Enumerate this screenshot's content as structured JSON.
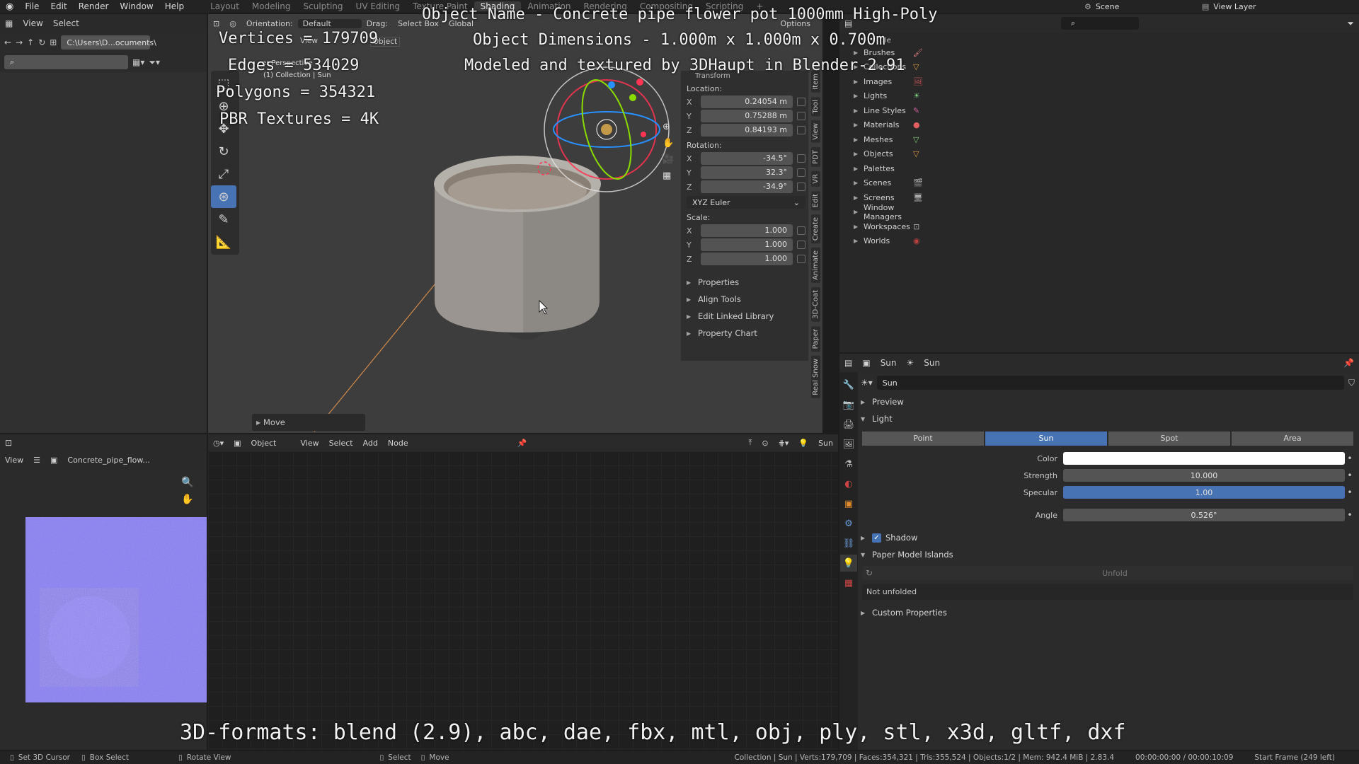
{
  "menu": {
    "items": [
      "File",
      "Edit",
      "Render",
      "Window",
      "Help"
    ],
    "workspaces": [
      "Layout",
      "Modeling",
      "Sculpting",
      "UV Editing",
      "Texture Paint",
      "Shading",
      "Animation",
      "Rendering",
      "Compositing",
      "Scripting"
    ],
    "active_workspace": "Shading",
    "add": "+",
    "scene_label": "Scene",
    "view_layer_label": "View Layer"
  },
  "file_browser": {
    "view": "View",
    "select": "Select",
    "path": "C:\\Users\\D...ocuments\\"
  },
  "viewport_header": {
    "orientation_label": "Orientation:",
    "orientation_value": "Default",
    "drag_label": "Drag:",
    "drag_value": "Select Box",
    "transform": "Global",
    "options": "Options",
    "view": "View",
    "object": "Object",
    "sub_view": "er Perspective",
    "collection": "(1) Collection | Sun"
  },
  "n_panel": {
    "section": "Transform",
    "location_label": "Location:",
    "location": {
      "x": "0.24054 m",
      "y": "0.75288 m",
      "z": "0.84193 m"
    },
    "rotation_label": "Rotation:",
    "rotation": {
      "x": "-34.5°",
      "y": "32.3°",
      "z": "-34.9°"
    },
    "rotation_mode": "XYZ Euler",
    "scale_label": "Scale:",
    "scale": {
      "x": "1.000",
      "y": "1.000",
      "z": "1.000"
    },
    "panels": [
      "Properties",
      "Align Tools",
      "Edit Linked Library",
      "Property Chart"
    ],
    "tabs": [
      "Item",
      "Tool",
      "View",
      "PDT",
      "VR",
      "Edit",
      "Create",
      "Animate",
      "3D-Coat",
      "Paper",
      "Real Snow"
    ]
  },
  "move_panel": "Move",
  "overlay": {
    "name": "Object Name - Concrete pipe flower pot 1000mm High-Poly",
    "dimensions": "Object Dimensions - 1.000m x 1.000m x 0.700m",
    "modeled": "Modeled and textured by 3DHaupt in Blender-2.91",
    "vertices": "Vertices = 179709",
    "edges": "Edges = 534029",
    "polygons": "Polygons = 354321",
    "pbr": "PBR Textures = 4K",
    "formats": "3D-formats: blend (2.9), abc, dae, fbx, mtl, obj, ply, stl, x3d, gltf, dxf"
  },
  "outliner": {
    "items": [
      {
        "label": "Brushes"
      },
      {
        "label": "Collections"
      },
      {
        "label": "Images"
      },
      {
        "label": "Lights"
      },
      {
        "label": "Line Styles"
      },
      {
        "label": "Materials"
      },
      {
        "label": "Meshes"
      },
      {
        "label": "Objects"
      },
      {
        "label": "Palettes"
      },
      {
        "label": "Scenes"
      },
      {
        "label": "Screens"
      },
      {
        "label": "Window Managers"
      },
      {
        "label": "Workspaces"
      },
      {
        "label": "Worlds"
      }
    ],
    "extra_top": "le"
  },
  "node_editor": {
    "object": "Object",
    "view": "View",
    "select": "Select",
    "add": "Add",
    "node": "Node",
    "sun": "Sun"
  },
  "image_editor": {
    "view": "View",
    "image_name": "Concrete_pipe_flow..."
  },
  "properties": {
    "breadcrumb_1": "Sun",
    "breadcrumb_2": "Sun",
    "datablock": "Sun",
    "preview": "Preview",
    "light": "Light",
    "types": [
      "Point",
      "Sun",
      "Spot",
      "Area"
    ],
    "active_type": "Sun",
    "color_label": "Color",
    "strength_label": "Strength",
    "strength": "10.000",
    "specular_label": "Specular",
    "specular": "1.00",
    "specular_fraction": 1.0,
    "angle_label": "Angle",
    "angle": "0.526°",
    "shadow": "Shadow",
    "paper": "Paper Model Islands",
    "unfold": "Unfold",
    "not_unfolded": "Not unfolded",
    "custom": "Custom Properties"
  },
  "status": {
    "cursor": "Set 3D Cursor",
    "box": "Box Select",
    "rotate": "Rotate View",
    "select": "Select",
    "move": "Move",
    "stats": "Collection | Sun | Verts:179,709 | Faces:354,321 | Tris:355,524 | Objects:1/2 | Mem: 942.4 MiB | 2.83.4",
    "time": "00:00:00:00 / 00:00:10:09",
    "frame": "Start Frame (249 left)"
  },
  "colors": {
    "accent": "#4772b3",
    "light_color": "#ffffff",
    "axis_x": "#ff3352",
    "axis_y": "#8bdc00",
    "axis_z": "#2890ff"
  }
}
